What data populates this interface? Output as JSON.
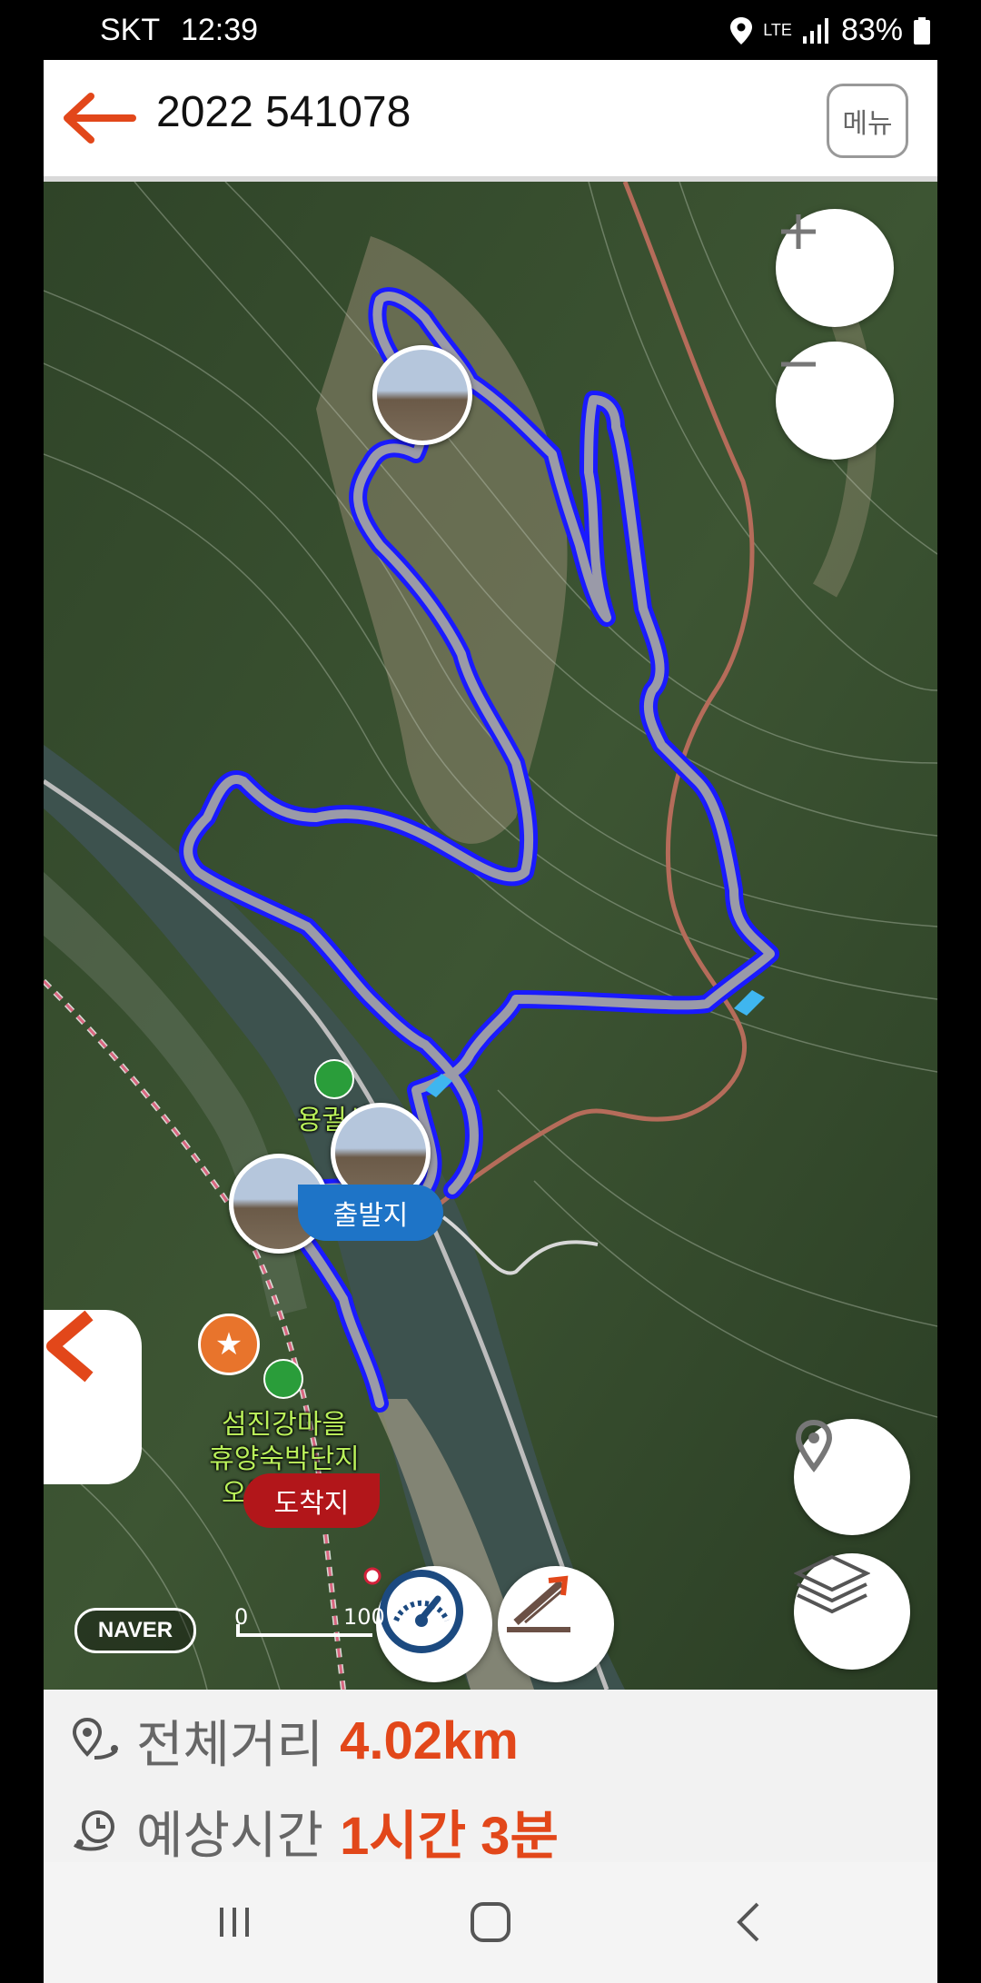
{
  "status_bar": {
    "carrier": "SKT",
    "time": "12:39",
    "network": "LTE",
    "battery": "83%"
  },
  "header": {
    "title": "2022 541078",
    "menu_label": "메뉴"
  },
  "map": {
    "attribution": "NAVER",
    "scale_start": "0",
    "scale_end": "100",
    "labels": {
      "mountain": "용궐산",
      "resort_line1": "섬진강마을",
      "resort_line2": "휴양숙박단지",
      "resort_line3": "오토캠핑장",
      "start": "출발지",
      "end": "도착지"
    },
    "icons": {
      "zoom_in": "plus-icon",
      "zoom_out": "minus-icon",
      "location": "location-pin-icon",
      "layers": "layers-icon",
      "speed": "speedometer-icon",
      "elevation": "elevation-graph-icon"
    }
  },
  "summary": {
    "distance_label": "전체거리",
    "distance_value": "4.02km",
    "time_label": "예상시간",
    "time_value": "1시간 3분"
  },
  "colors": {
    "accent": "#e2471a",
    "route": "#1a1aff",
    "start": "#1e74c7",
    "end": "#b2161a"
  }
}
